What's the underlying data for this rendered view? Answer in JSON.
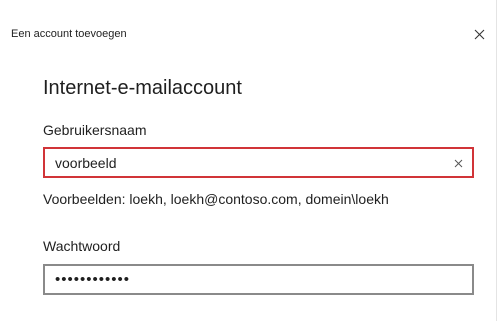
{
  "dialog": {
    "title": "Een account toevoegen",
    "close_icon": "close-icon"
  },
  "form": {
    "heading": "Internet-e-mailaccount",
    "username": {
      "label": "Gebruikersnaam",
      "value": "voorbeeld",
      "clear_icon": "clear-icon",
      "border_color": "#d13438"
    },
    "examples": "Voorbeelden: loekh, loekh@contoso.com, domein\\loekh",
    "password": {
      "label": "Wachtwoord",
      "value": "wachtwoord12",
      "border_color": "#8a8a8a"
    }
  }
}
